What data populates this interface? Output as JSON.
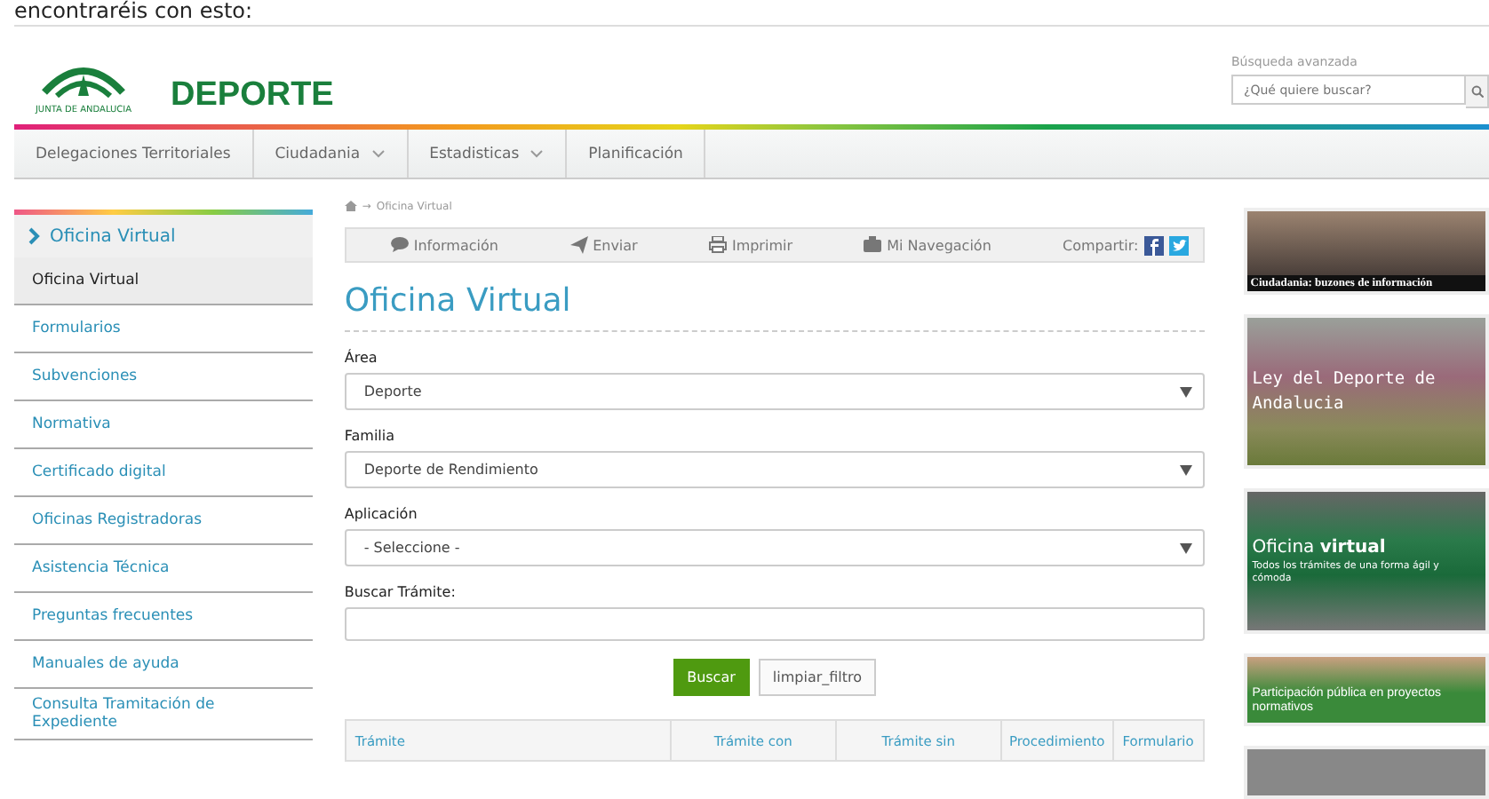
{
  "caption": "encontraréis con esto:",
  "header": {
    "logo_text": "JUNTA DE ANDALUCIA",
    "site_title": "DEPORTE",
    "search_label": "Búsqueda avanzada",
    "search": {
      "placeholder": "¿Qué quiere buscar?"
    }
  },
  "nav": [
    {
      "label": "Delegaciones Territoriales",
      "dropdown": false
    },
    {
      "label": "Ciudadania",
      "dropdown": true
    },
    {
      "label": "Estadisticas",
      "dropdown": true
    },
    {
      "label": "Planificación",
      "dropdown": false
    }
  ],
  "sidebar": {
    "title": "Oficina Virtual",
    "items": [
      {
        "label": "Oficina Virtual",
        "selected": true
      },
      {
        "label": "Formularios",
        "selected": false
      },
      {
        "label": "Subvenciones",
        "selected": false
      },
      {
        "label": "Normativa",
        "selected": false
      },
      {
        "label": "Certificado digital",
        "selected": false
      },
      {
        "label": "Oficinas Registradoras",
        "selected": false
      },
      {
        "label": "Asistencia Técnica",
        "selected": false
      },
      {
        "label": "Preguntas frecuentes",
        "selected": false
      },
      {
        "label": "Manuales de ayuda",
        "selected": false
      },
      {
        "label": "Consulta Tramitación de Expediente",
        "selected": false
      }
    ]
  },
  "breadcrumb_separator": "→",
  "breadcrumb": "Oficina Virtual",
  "toolbar": [
    {
      "kind": "info",
      "label": "Información"
    },
    {
      "kind": "send",
      "label": "Enviar"
    },
    {
      "kind": "print",
      "label": "Imprimir"
    },
    {
      "kind": "nav",
      "label": "Mi Navegación"
    },
    {
      "kind": "share",
      "label": "Compartir:"
    }
  ],
  "page_title": "Oficina Virtual",
  "form": [
    {
      "kind": "select",
      "label": "Área",
      "value": "Deporte"
    },
    {
      "kind": "select",
      "label": "Familia",
      "value": "Deporte de Rendimiento"
    },
    {
      "kind": "select",
      "label": "Aplicación",
      "value": "- Seleccione -"
    },
    {
      "kind": "text",
      "label": "Buscar Trámite:"
    }
  ],
  "buttons": [
    {
      "kind": "primary",
      "label": "Buscar"
    },
    {
      "kind": "secondary",
      "label": "limpiar_filtro"
    }
  ],
  "table": {
    "columns": [
      "Trámite",
      "Trámite con",
      "Trámite sin",
      "Procedimiento",
      "Formulario"
    ]
  },
  "banners": [
    {
      "kind": "caption-bottom",
      "text": "Ciudadania: buzones de información"
    },
    {
      "kind": "overlay",
      "text": "Ley del Deporte de Andalucia"
    },
    {
      "kind": "green",
      "text": "Oficina **virtual**",
      "subtext": "Todos los trámites de una forma ágil y cómoda"
    },
    {
      "kind": "green-small",
      "text": "Participación pública en proyectos normativos"
    }
  ]
}
